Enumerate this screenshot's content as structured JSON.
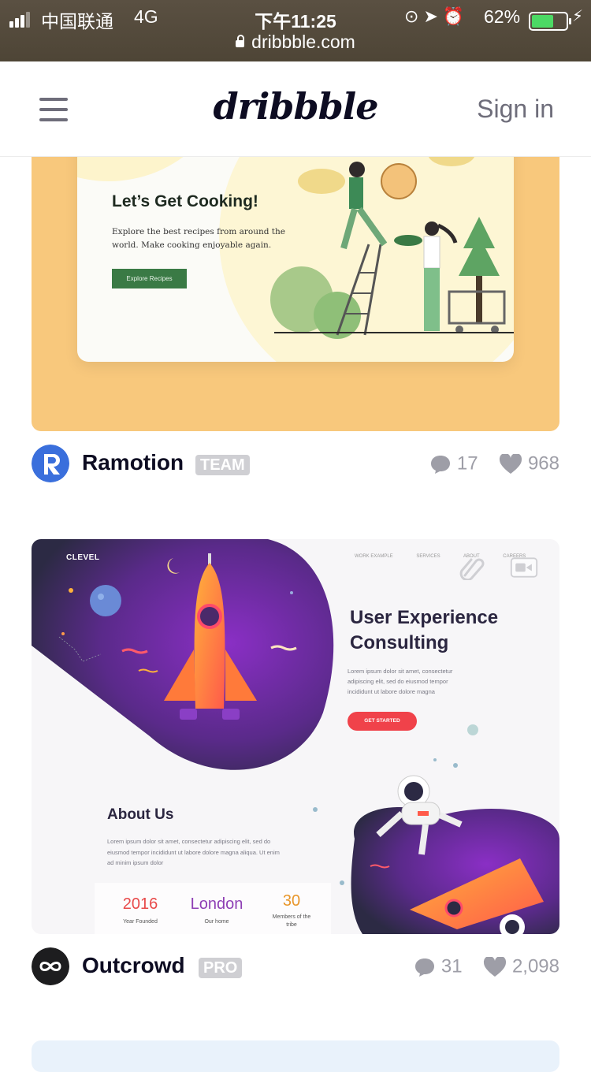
{
  "status_bar": {
    "carrier": "中国联通",
    "network": "4G",
    "time": "下午11:25",
    "battery_percent": "62%",
    "icons": [
      "orientation-lock-icon",
      "location-icon",
      "alarm-icon"
    ]
  },
  "browser": {
    "url": "dribbble.com"
  },
  "nav": {
    "logo": "dribbble",
    "signin_label": "Sign in"
  },
  "shots": [
    {
      "preview": {
        "title": "Let’s Get Cooking!",
        "description": "Explore the best recipes from around the world. Make cooking enjoyable again.",
        "button_label": "Explore Recipes"
      },
      "author": "Ramotion",
      "badge": "TEAM",
      "comments": "17",
      "likes": "968",
      "colors": {
        "background": "#f8c87c",
        "avatar": "#3a6fdc"
      }
    },
    {
      "preview": {
        "logo": "CLEVEL",
        "nav": [
          "WORK EXAMPLE",
          "SERVICES",
          "ABOUT",
          "CAREERS"
        ],
        "title": "User Experience Consulting",
        "description": "Lorem ipsum dolor sit amet, consectetur adipiscing elit, sed do eiusmod tempor incididunt ut labore dolore magna",
        "button_label": "GET STARTED",
        "about_title": "About Us",
        "about_description": "Lorem ipsum dolor sit amet, consectetur adipiscing elit, sed do eiusmod tempor incididunt ut labore dolore magna aliqua. Ut enim ad minim ipsum dolor",
        "stats": [
          {
            "value": "2016",
            "label": "Year Founded",
            "color": "#e84a4a"
          },
          {
            "value": "London",
            "label": "Our home",
            "color": "#8e3fb5"
          },
          {
            "value": "30",
            "label": "Members of the tribe",
            "color": "#e8962a"
          }
        ]
      },
      "author": "Outcrowd",
      "badge": "PRO",
      "comments": "31",
      "likes": "2,098",
      "colors": {
        "avatar": "#1d1d1f"
      }
    }
  ]
}
